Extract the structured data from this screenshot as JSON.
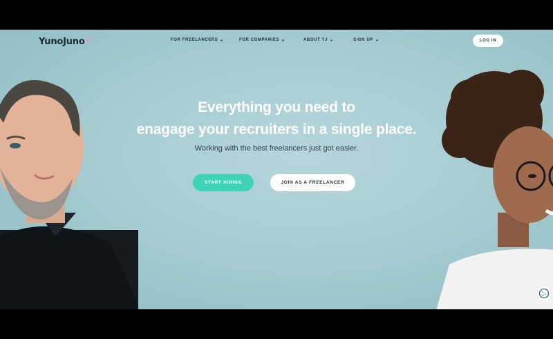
{
  "brand": {
    "logo_text": "YunoJuno"
  },
  "nav": {
    "items": [
      {
        "label": "FOR FREELANCERS"
      },
      {
        "label": "FOR COMPANIES"
      },
      {
        "label": "ABOUT YJ"
      },
      {
        "label": "SIGN UP"
      }
    ],
    "login_label": "LOG IN"
  },
  "hero": {
    "headline_line1": "Everything you need to",
    "headline_line2": "enagage your recruiters in a single place.",
    "subtitle": "Working with the best freelancers just got easier.",
    "primary_cta": "START HIRING",
    "secondary_cta": "JOIN AS A FREELANCER"
  },
  "colors": {
    "accent": "#3ed3b4",
    "hero_bg": "#a6cdd2",
    "text_dark": "#1d2b33"
  },
  "icons": [
    "chevron-down-icon",
    "cookie-icon",
    "logo-mark-icon"
  ]
}
